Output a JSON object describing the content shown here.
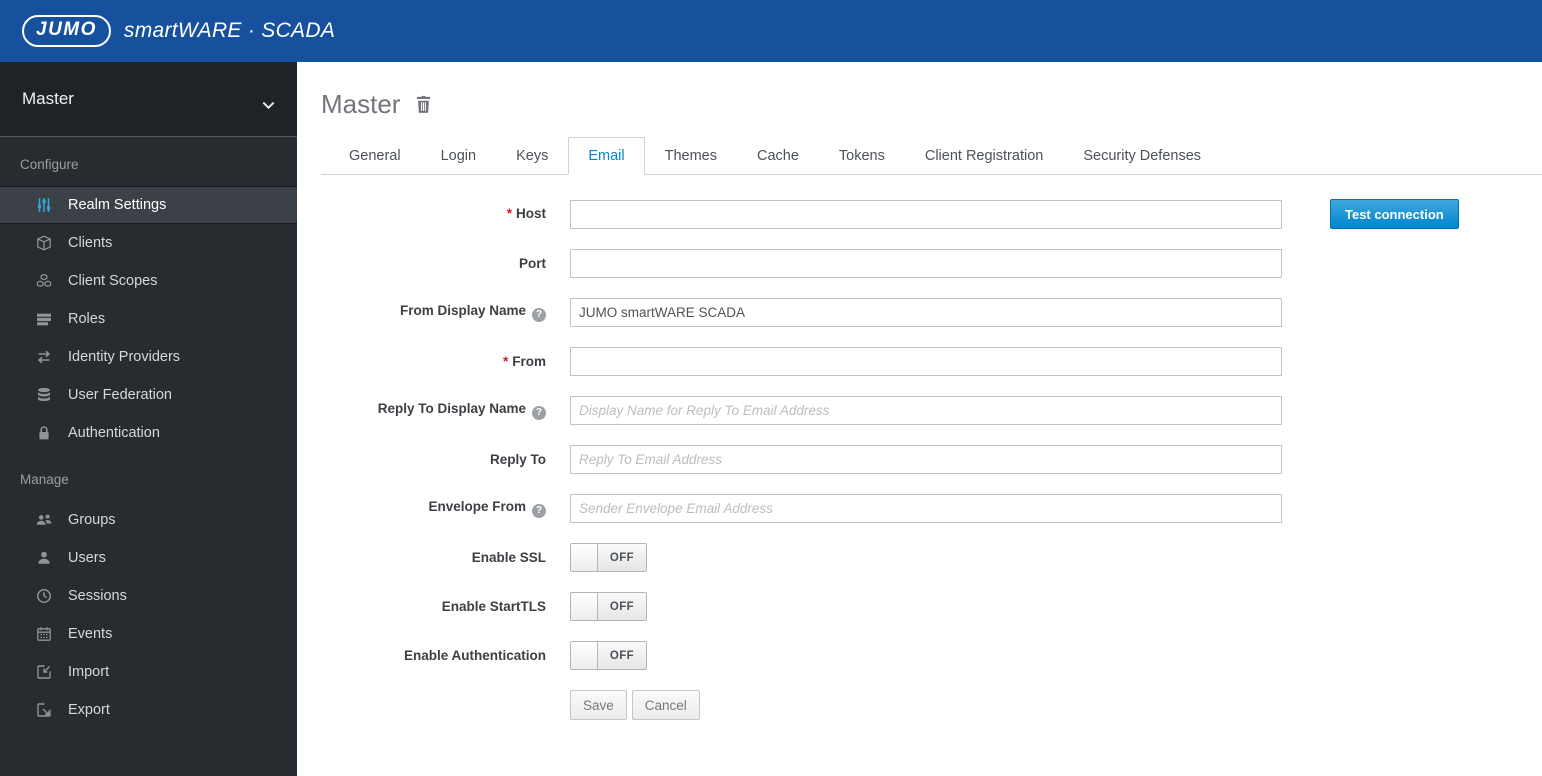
{
  "colors": {
    "header_blue": "#17519E",
    "accent": "#0088ce",
    "icon_active": "#39a5dc",
    "required_red": "#cb2026",
    "sidebar_bg": "#282c31",
    "selector_bg": "#1f2226",
    "active_item": "#3c4147"
  },
  "header": {
    "logo": "JUMO",
    "product": "smartWARE · SCADA"
  },
  "sidebar": {
    "realm_selector": {
      "label": "Master"
    },
    "sections": [
      {
        "title": "Configure",
        "items": [
          {
            "label": "Realm Settings",
            "icon": "sliders-icon",
            "active": true
          },
          {
            "label": "Clients",
            "icon": "cube-icon",
            "active": false
          },
          {
            "label": "Client Scopes",
            "icon": "cubes-icon",
            "active": false
          },
          {
            "label": "Roles",
            "icon": "list-icon",
            "active": false
          },
          {
            "label": "Identity Providers",
            "icon": "exchange-icon",
            "active": false
          },
          {
            "label": "User Federation",
            "icon": "database-icon",
            "active": false
          },
          {
            "label": "Authentication",
            "icon": "lock-icon",
            "active": false
          }
        ]
      },
      {
        "title": "Manage",
        "items": [
          {
            "label": "Groups",
            "icon": "groups-icon",
            "active": false
          },
          {
            "label": "Users",
            "icon": "user-icon",
            "active": false
          },
          {
            "label": "Sessions",
            "icon": "clock-icon",
            "active": false
          },
          {
            "label": "Events",
            "icon": "calendar-icon",
            "active": false
          },
          {
            "label": "Import",
            "icon": "import-icon",
            "active": false
          },
          {
            "label": "Export",
            "icon": "export-icon",
            "active": false
          }
        ]
      }
    ]
  },
  "main": {
    "title": "Master",
    "tabs": [
      {
        "label": "General",
        "active": false
      },
      {
        "label": "Login",
        "active": false
      },
      {
        "label": "Keys",
        "active": false
      },
      {
        "label": "Email",
        "active": true
      },
      {
        "label": "Themes",
        "active": false
      },
      {
        "label": "Cache",
        "active": false
      },
      {
        "label": "Tokens",
        "active": false
      },
      {
        "label": "Client Registration",
        "active": false
      },
      {
        "label": "Security Defenses",
        "active": false
      }
    ],
    "form": {
      "required_marker": "*",
      "help_glyph": "?",
      "fields": [
        {
          "label": "Host",
          "type": "text",
          "required": true,
          "help": false,
          "value": "",
          "placeholder": "",
          "test_button": true
        },
        {
          "label": "Port",
          "type": "text",
          "required": false,
          "help": false,
          "value": "",
          "placeholder": ""
        },
        {
          "label": "From Display Name",
          "type": "text",
          "required": false,
          "help": true,
          "value": "JUMO smartWARE SCADA",
          "placeholder": ""
        },
        {
          "label": "From",
          "type": "text",
          "required": true,
          "help": false,
          "value": "",
          "placeholder": ""
        },
        {
          "label": "Reply To Display Name",
          "type": "text",
          "required": false,
          "help": true,
          "value": "",
          "placeholder": "Display Name for Reply To Email Address"
        },
        {
          "label": "Reply To",
          "type": "text",
          "required": false,
          "help": false,
          "value": "",
          "placeholder": "Reply To Email Address"
        },
        {
          "label": "Envelope From",
          "type": "text",
          "required": false,
          "help": true,
          "value": "",
          "placeholder": "Sender Envelope Email Address"
        },
        {
          "label": "Enable SSL",
          "type": "toggle",
          "state": "OFF"
        },
        {
          "label": "Enable StartTLS",
          "type": "toggle",
          "state": "OFF"
        },
        {
          "label": "Enable Authentication",
          "type": "toggle",
          "state": "OFF"
        }
      ],
      "actions": {
        "save": "Save",
        "cancel": "Cancel"
      },
      "test_connection_label": "Test connection"
    }
  }
}
